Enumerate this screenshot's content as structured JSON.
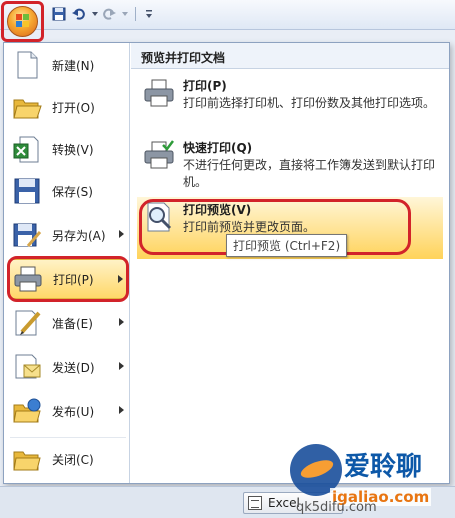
{
  "quick_access": {
    "icons": [
      "office-logo-icon",
      "save-icon",
      "undo-icon",
      "redo-icon",
      "customize-icon"
    ]
  },
  "left_menu": {
    "items": [
      {
        "label": "新建(N)",
        "icon": "new-doc-icon",
        "submenu": false
      },
      {
        "label": "打开(O)",
        "icon": "open-folder-icon",
        "submenu": false
      },
      {
        "label": "转换(V)",
        "icon": "convert-icon",
        "submenu": false
      },
      {
        "label": "保存(S)",
        "icon": "save-icon",
        "submenu": false
      },
      {
        "label": "另存为(A)",
        "icon": "save-as-icon",
        "submenu": true
      },
      {
        "label": "打印(P)",
        "icon": "printer-icon",
        "submenu": true,
        "active": true
      },
      {
        "label": "准备(E)",
        "icon": "prepare-icon",
        "submenu": true
      },
      {
        "label": "发送(D)",
        "icon": "send-icon",
        "submenu": true
      },
      {
        "label": "发布(U)",
        "icon": "publish-icon",
        "submenu": true
      },
      {
        "label": "关闭(C)",
        "icon": "close-folder-icon",
        "submenu": false
      }
    ]
  },
  "right_panel": {
    "title": "预览并打印文档",
    "items": [
      {
        "title": "打印(P)",
        "desc": "打印前选择打印机、打印份数及其他打印选项。",
        "icon": "printer-icon"
      },
      {
        "title": "快速打印(Q)",
        "desc": "不进行任何更改，直接将工作簿发送到默认打印机。",
        "icon": "quick-print-icon"
      },
      {
        "title": "打印预览(V)",
        "desc": "打印前预览并更改页面。",
        "icon": "print-preview-icon",
        "active": true
      }
    ],
    "tooltip": "打印预览 (Ctrl+F2)"
  },
  "taskbar": {
    "label": "Excel"
  },
  "watermark": {
    "brand": "爱聆聊",
    "url": "igaliao.com",
    "url2": "qk5difu.com"
  },
  "colors": {
    "highlight_red": "#d2232a",
    "active_gold": "#ffd35a",
    "accent_blue": "#2a4d8f"
  }
}
